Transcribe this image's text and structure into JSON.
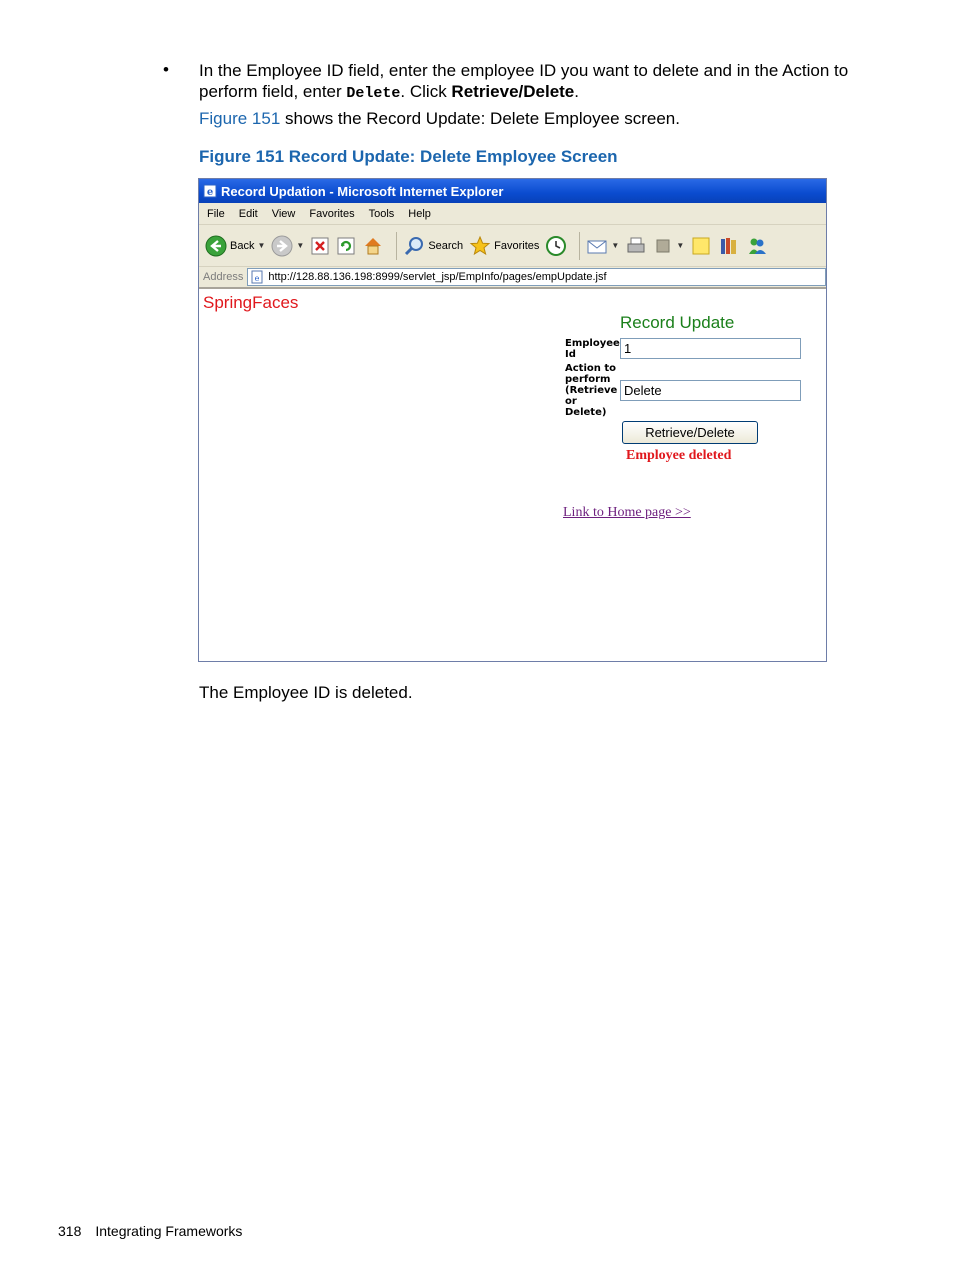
{
  "body": {
    "bullet_char": "•",
    "step_text_1": "In the Employee ID field, enter the employee ID you want to delete and in the Action to perform field, enter ",
    "step_code": "Delete",
    "step_text_2": ". Click ",
    "step_bold": "Retrieve/Delete",
    "step_text_3": ".",
    "figref_link": "Figure 151",
    "figref_text": " shows the Record Update: Delete Employee screen.",
    "caption": "Figure 151 Record Update: Delete Employee Screen",
    "result_text": "The Employee ID is deleted."
  },
  "browser": {
    "title": "Record Updation - Microsoft Internet Explorer",
    "menu": [
      "File",
      "Edit",
      "View",
      "Favorites",
      "Tools",
      "Help"
    ],
    "toolbar": {
      "back": "Back",
      "search": "Search",
      "favorites": "Favorites"
    },
    "address_label": "Address",
    "url": "http://128.88.136.198:8999/servlet_jsp/EmpInfo/pages/empUpdate.jsf",
    "page": {
      "brand": "SpringFaces",
      "title": "Record Update",
      "employee_id_label": "Employee Id",
      "employee_id_value": "1",
      "action_label": "Action to perform (Retrieve or Delete)",
      "action_value": "Delete",
      "button": "Retrieve/Delete",
      "status": "Employee deleted",
      "home_link": "Link to Home page >>"
    }
  },
  "footer": {
    "page_number": "318",
    "section": "Integrating Frameworks"
  },
  "colors": {
    "link_blue": "#1c66ae",
    "brand_red": "#e0181d",
    "title_green": "#1a7f1a",
    "visited_link": "#6d1f7e",
    "titlebar_blue": "#0a4bcf"
  }
}
